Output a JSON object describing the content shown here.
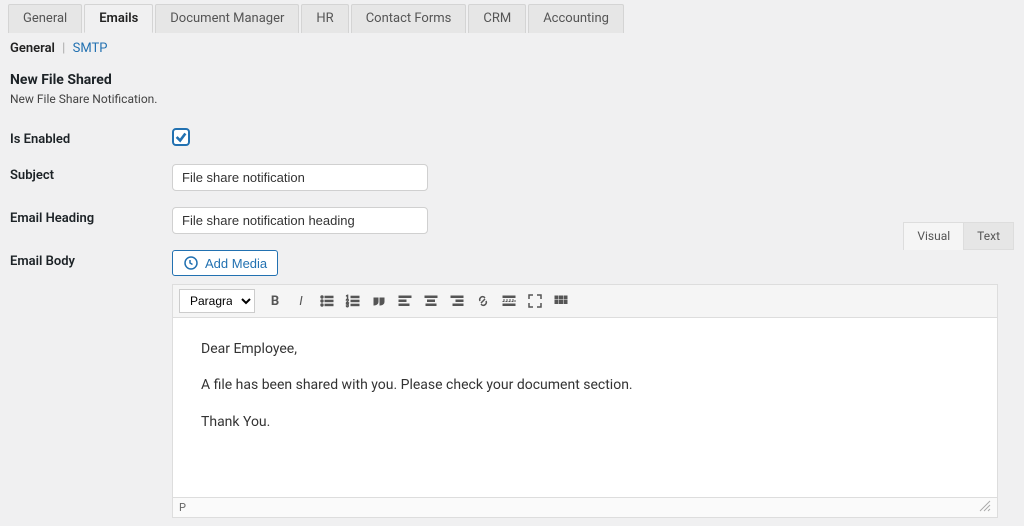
{
  "tabs": [
    {
      "label": "General",
      "active": false
    },
    {
      "label": "Emails",
      "active": true
    },
    {
      "label": "Document Manager",
      "active": false
    },
    {
      "label": "HR",
      "active": false
    },
    {
      "label": "Contact Forms",
      "active": false
    },
    {
      "label": "CRM",
      "active": false
    },
    {
      "label": "Accounting",
      "active": false
    }
  ],
  "subtabs": {
    "current": "General",
    "link": "SMTP"
  },
  "section": {
    "title": "New File Shared",
    "description": "New File Share Notification."
  },
  "fields": {
    "enabled": {
      "label": "Is Enabled",
      "checked": true
    },
    "subject": {
      "label": "Subject",
      "value": "File share notification"
    },
    "heading": {
      "label": "Email Heading",
      "value": "File share notification heading"
    },
    "body": {
      "label": "Email Body"
    }
  },
  "editor": {
    "add_media": "Add Media",
    "tabs": [
      {
        "label": "Visual",
        "active": true
      },
      {
        "label": "Text",
        "active": false
      }
    ],
    "format": "Paragraph",
    "content": {
      "p1": "Dear Employee,",
      "p2": "A file has been shared with you. Please check your document section.",
      "p3": "Thank You."
    },
    "status_path": "P"
  }
}
